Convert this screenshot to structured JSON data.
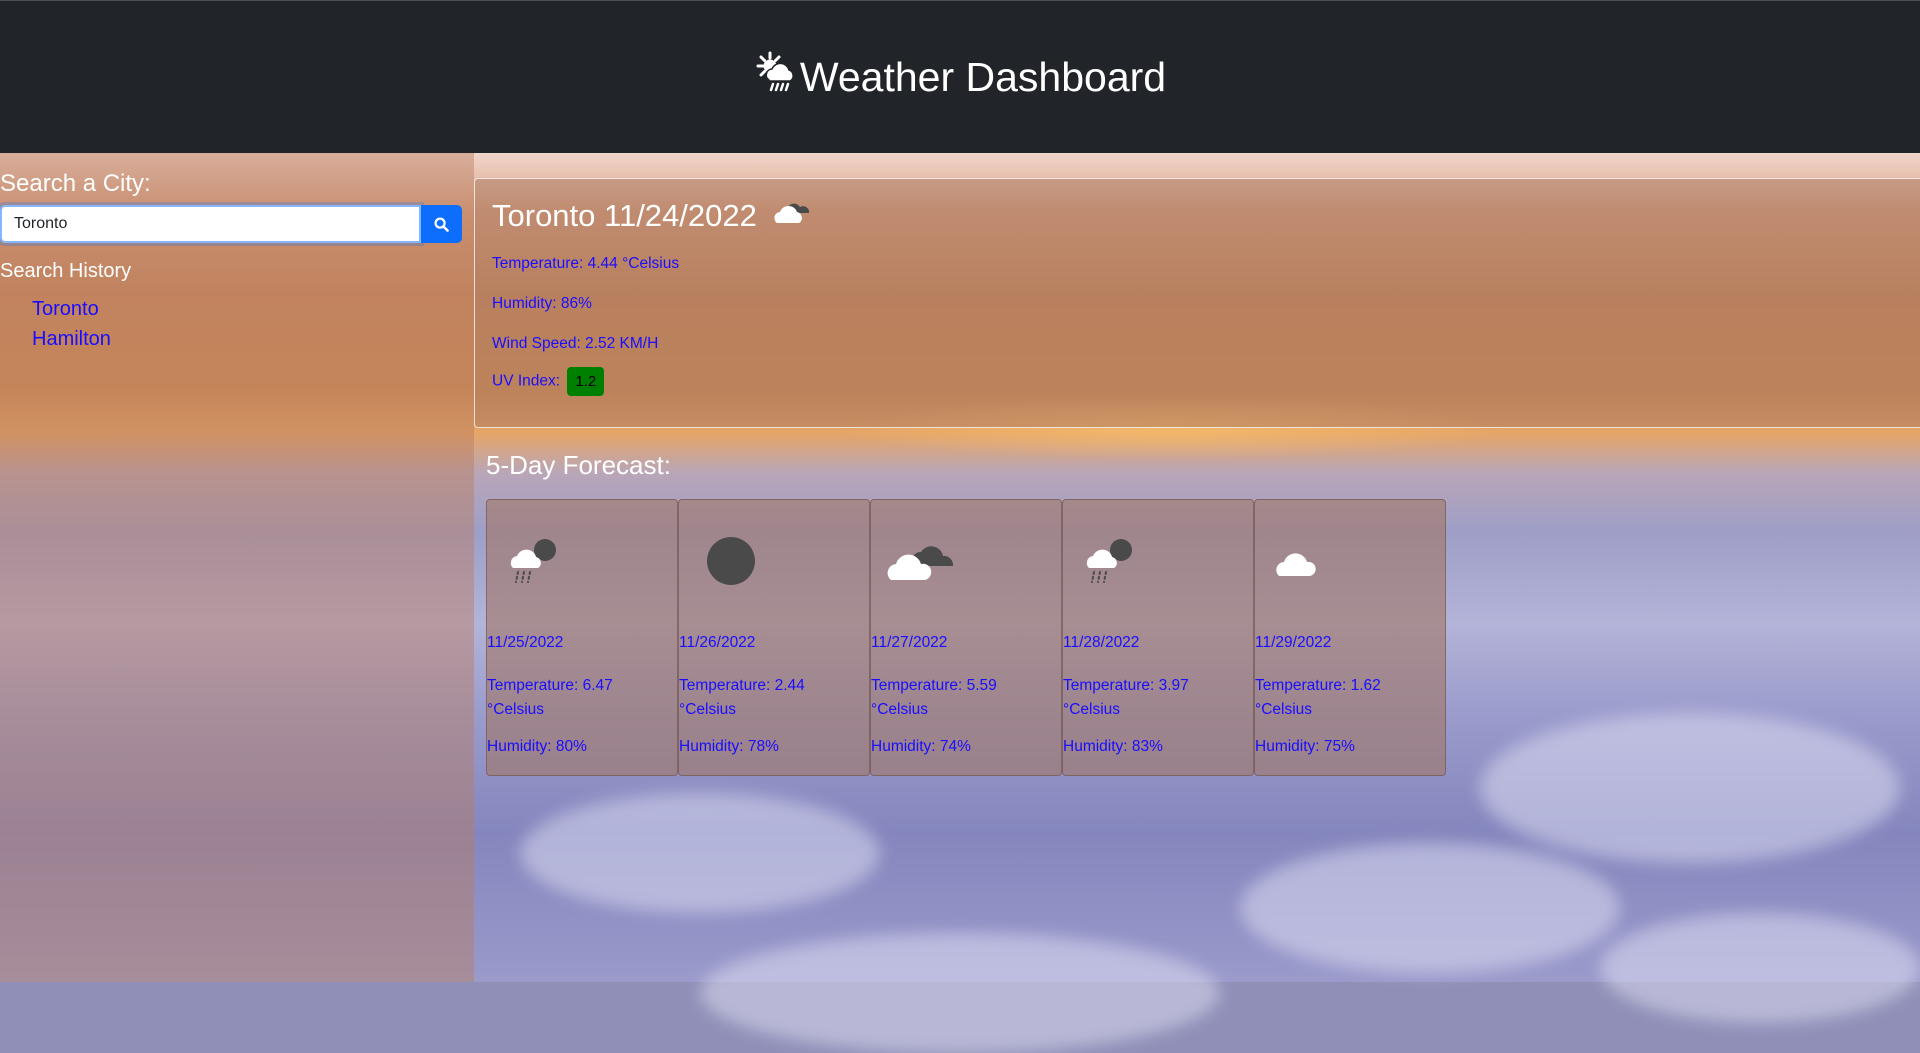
{
  "header": {
    "title": "Weather Dashboard",
    "icon": "sun-behind-rain-cloud-icon"
  },
  "sidebar": {
    "search_label": "Search a City:",
    "search_value": "Toronto",
    "history_label": "Search History",
    "history": [
      "Toronto",
      "Hamilton"
    ]
  },
  "current": {
    "title": "Toronto 11/24/2022",
    "icon": "cloud-icon",
    "temperature": "Temperature: 4.44 °Celsius",
    "humidity": "Humidity: 86%",
    "wind": "Wind Speed: 2.52 KM/H",
    "uv_label": "UV Index:",
    "uv_value": "1.2",
    "uv_color": "#008000"
  },
  "forecast": {
    "title": "5-Day Forecast:",
    "days": [
      {
        "date": "11/25/2022",
        "temp": "Temperature: 6.47 °Celsius",
        "humidity": "Humidity: 80%",
        "icon": "rain-moon-icon"
      },
      {
        "date": "11/26/2022",
        "temp": "Temperature: 2.44 °Celsius",
        "humidity": "Humidity: 78%",
        "icon": "dark-circle-icon"
      },
      {
        "date": "11/27/2022",
        "temp": "Temperature: 5.59 °Celsius",
        "humidity": "Humidity: 74%",
        "icon": "broken-clouds-icon"
      },
      {
        "date": "11/28/2022",
        "temp": "Temperature: 3.97 °Celsius",
        "humidity": "Humidity: 83%",
        "icon": "rain-moon-icon"
      },
      {
        "date": "11/29/2022",
        "temp": "Temperature: 1.62 °Celsius",
        "humidity": "Humidity: 75%",
        "icon": "cloud-icon"
      }
    ]
  }
}
